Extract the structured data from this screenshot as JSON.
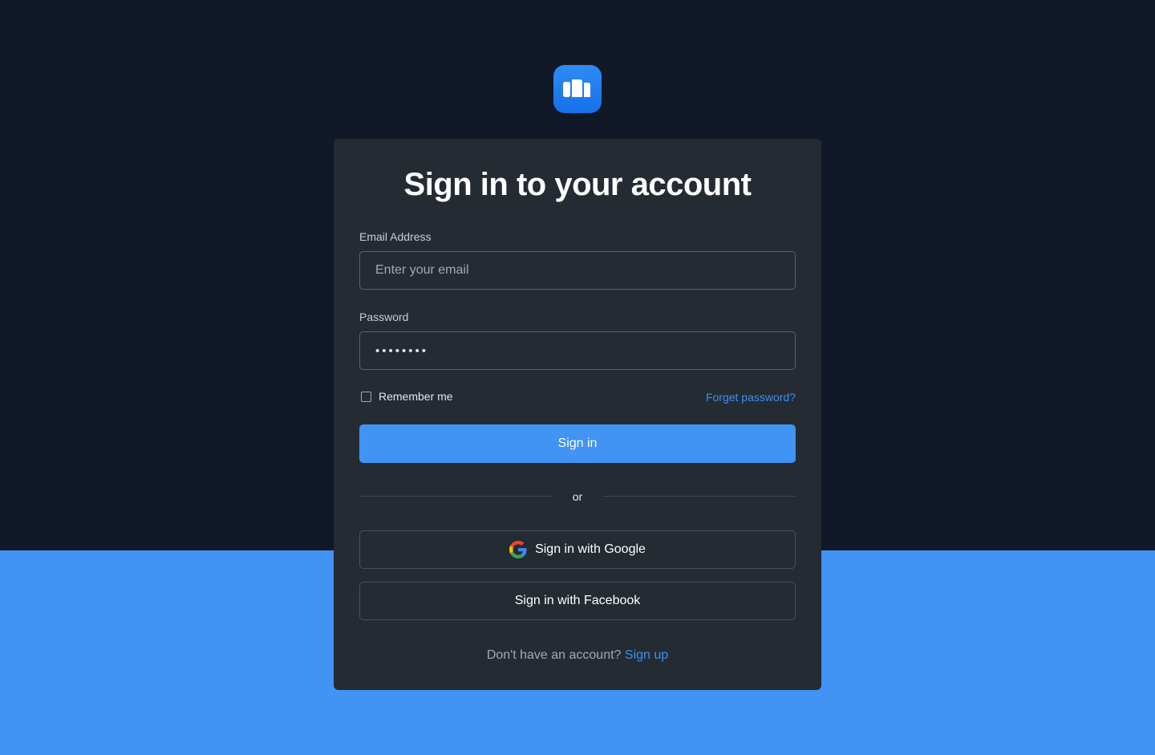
{
  "page": {
    "title": "Sign in to your account"
  },
  "form": {
    "email": {
      "label": "Email Address",
      "placeholder": "Enter your email",
      "value": ""
    },
    "password": {
      "label": "Password",
      "value": "••••••••"
    },
    "remember": {
      "label": "Remember me",
      "checked": false
    },
    "forgot_label": "Forget password?",
    "submit_label": "Sign in"
  },
  "divider": {
    "text": "or"
  },
  "social": {
    "google_label": "Sign in with Google",
    "facebook_label": "Sign in with Facebook"
  },
  "footer": {
    "prompt": "Don't have an account?",
    "link_label": "Sign up"
  },
  "icons": {
    "logo": "book-logo-icon",
    "google": "google-icon"
  },
  "colors": {
    "background_dark": "#111827",
    "background_accent": "#4193f4",
    "card": "#252b33",
    "primary": "#4193f4",
    "link": "#3e8ef0"
  }
}
